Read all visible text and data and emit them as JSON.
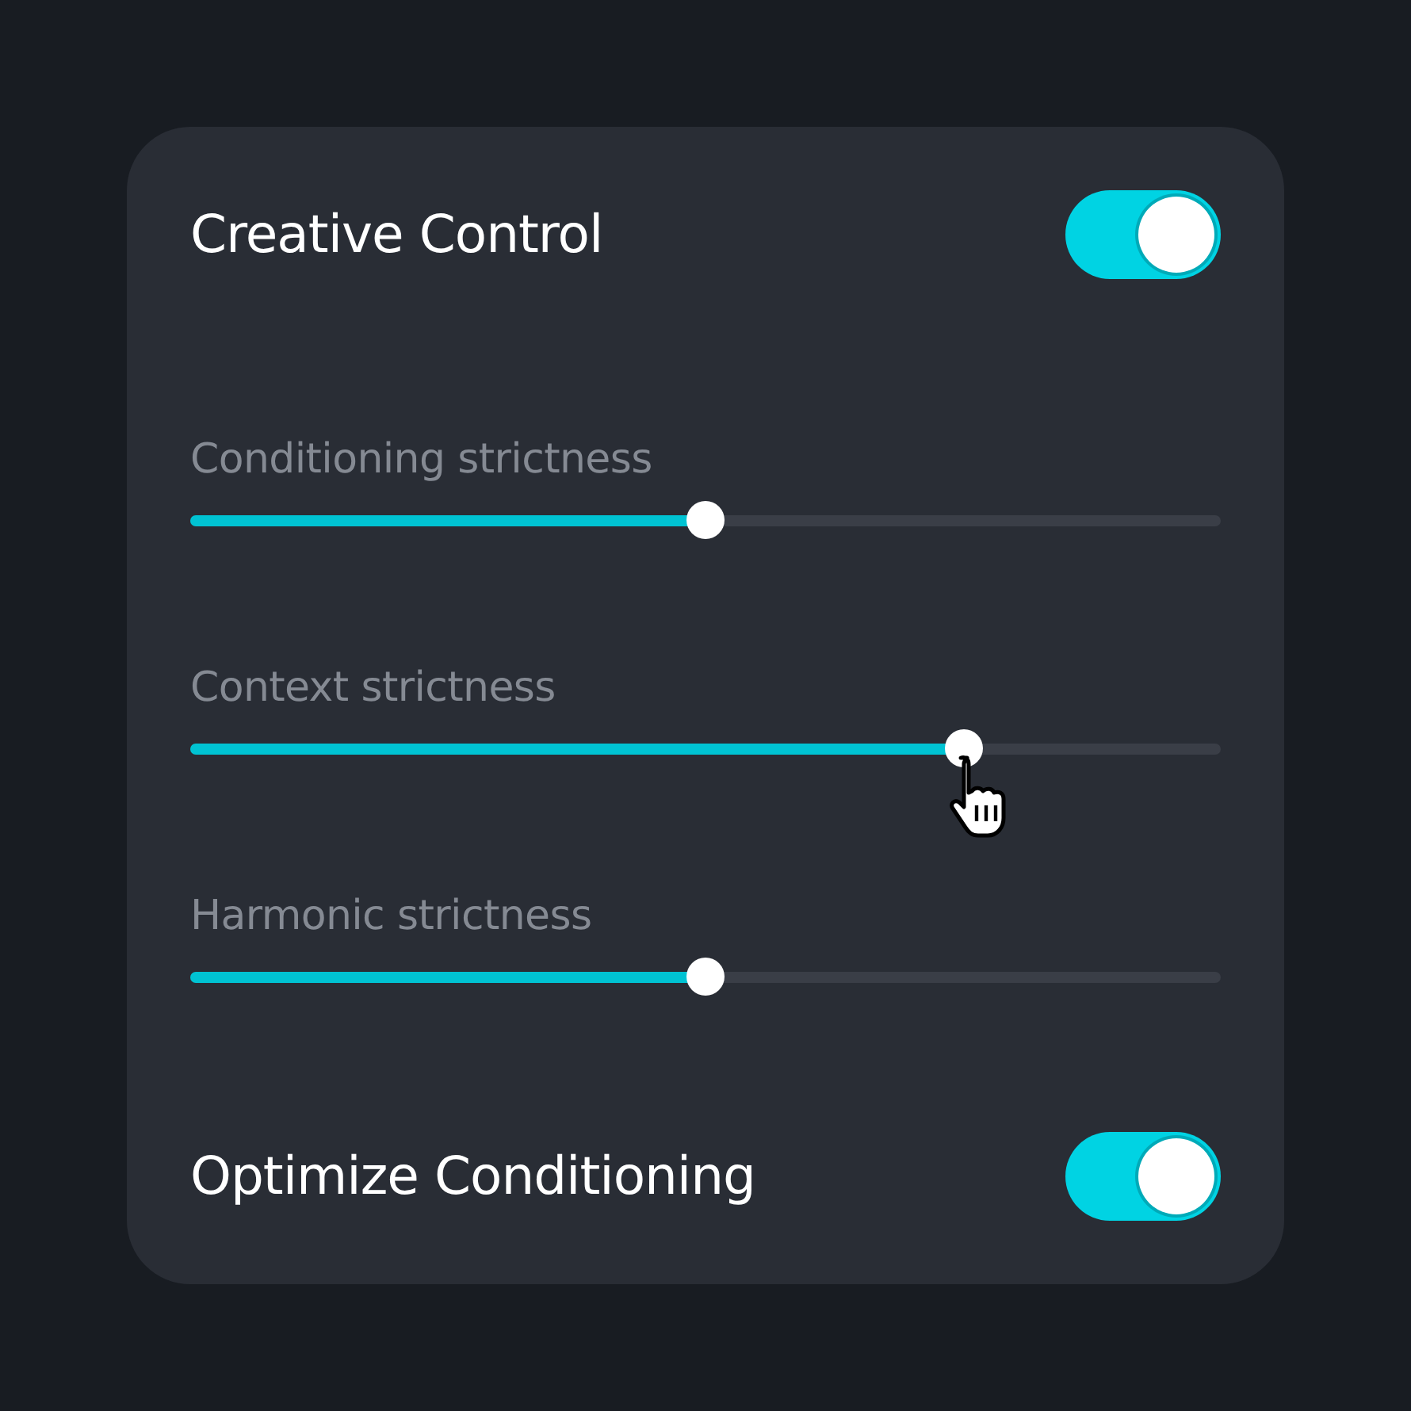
{
  "panel": {
    "items": [
      {
        "kind": "toggle",
        "label": "Creative Control",
        "on": true
      },
      {
        "kind": "slider",
        "label": "Conditioning strictness",
        "level": 0.5
      },
      {
        "kind": "slider",
        "label": "Context strictness",
        "level": 0.75,
        "cursor": true
      },
      {
        "kind": "slider",
        "label": "Harmonic strictness",
        "level": 0.5
      },
      {
        "kind": "toggle",
        "label": "Optimize Conditioning",
        "on": true
      }
    ]
  }
}
